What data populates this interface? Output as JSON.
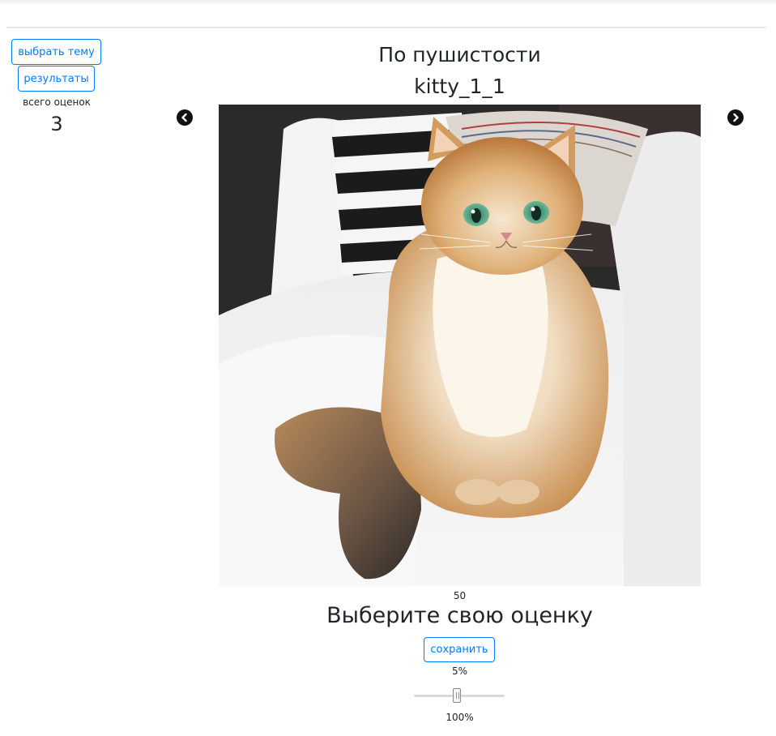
{
  "sidebar": {
    "choose_topic_label": "выбрать тему",
    "results_label": "результаты",
    "total_ratings_label": "всего оценок",
    "total_ratings_value": "3"
  },
  "main": {
    "topic_title": "По пушистости",
    "image_title": "kitty_1_1",
    "prev_icon": "chevron-left-circle-icon",
    "next_icon": "chevron-right-circle-icon",
    "photo_subject": "fluffy ginger cat on white sofa"
  },
  "rating": {
    "current_value": "50",
    "heading": "Выберите свою оценку",
    "save_label": "сохранить",
    "min_label": "5%",
    "max_label": "100%",
    "slider_value_fraction": 0.47
  },
  "colors": {
    "accent": "#007bff",
    "text": "#212529"
  }
}
